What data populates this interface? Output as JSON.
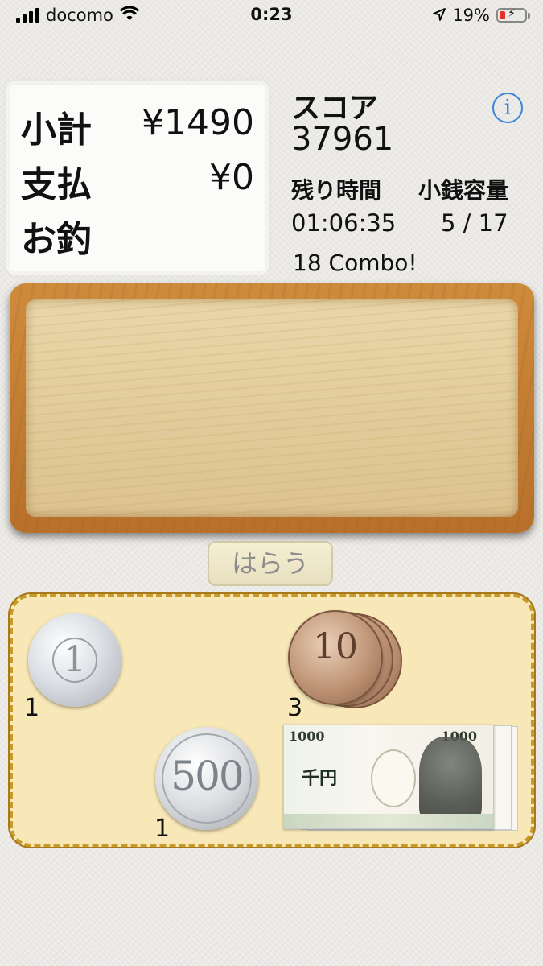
{
  "status_bar": {
    "carrier": "docomo",
    "time": "0:23",
    "battery": "19%"
  },
  "receipt": {
    "subtotal_label": "小計",
    "subtotal_value": "¥1490",
    "payment_label": "支払",
    "payment_value": "¥0",
    "change_label": "お釣",
    "change_value": ""
  },
  "score": {
    "label": "スコア",
    "value": "37961"
  },
  "info": {
    "glyph": "i"
  },
  "stats": {
    "time_label": "残り時間",
    "time_value": "01:06:35",
    "capacity_label": "小銭容量",
    "capacity_value": "5 / 17"
  },
  "combo": "18 Combo!",
  "pay_button": "はらう",
  "wallet": {
    "coin_1": {
      "face": "1",
      "count": "1"
    },
    "coin_10": {
      "face": "10",
      "count": "3"
    },
    "coin_500": {
      "face": "500",
      "count": "1"
    },
    "note_1000": {
      "denomination_left": "1000",
      "denomination_right": "1000",
      "kanji": "千円"
    }
  }
}
